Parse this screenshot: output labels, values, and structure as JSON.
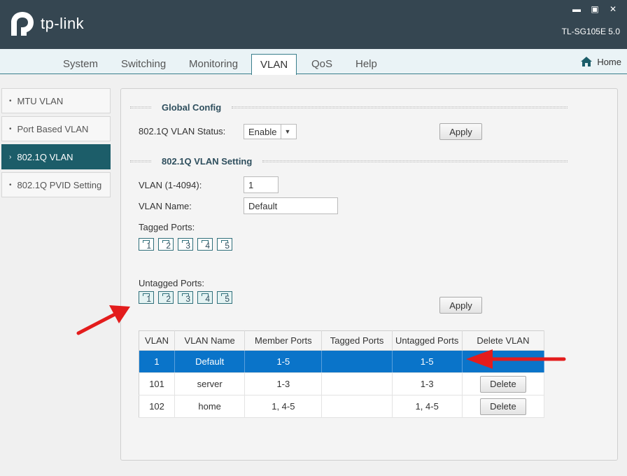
{
  "window": {
    "model": "TL-SG105E 5.0",
    "brand": "tp-link"
  },
  "tabs": [
    {
      "label": "System"
    },
    {
      "label": "Switching"
    },
    {
      "label": "Monitoring"
    },
    {
      "label": "VLAN"
    },
    {
      "label": "QoS"
    },
    {
      "label": "Help"
    }
  ],
  "home_label": "Home",
  "sidebar": [
    {
      "label": "MTU VLAN"
    },
    {
      "label": "Port Based VLAN"
    },
    {
      "label": "802.1Q VLAN"
    },
    {
      "label": "802.1Q PVID Setting"
    }
  ],
  "global": {
    "title": "Global Config",
    "status_label": "802.1Q VLAN Status:",
    "status_value": "Enable",
    "apply": "Apply"
  },
  "setting": {
    "title": "802.1Q VLAN Setting",
    "vlan_label": "VLAN (1-4094):",
    "vlan_value": "1",
    "name_label": "VLAN Name:",
    "name_value": "Default",
    "tagged_label": "Tagged Ports:",
    "untagged_label": "Untagged Ports:",
    "ports": [
      "1",
      "2",
      "3",
      "4",
      "5"
    ],
    "apply": "Apply"
  },
  "table": {
    "headers": [
      "VLAN",
      "VLAN Name",
      "Member Ports",
      "Tagged Ports",
      "Untagged Ports",
      "Delete VLAN"
    ],
    "rows": [
      {
        "vlan": "1",
        "name": "Default",
        "member": "1-5",
        "tagged": "",
        "untagged": "1-5",
        "delete": ""
      },
      {
        "vlan": "101",
        "name": "server",
        "member": "1-3",
        "tagged": "",
        "untagged": "1-3",
        "delete": "Delete"
      },
      {
        "vlan": "102",
        "name": "home",
        "member": "1, 4-5",
        "tagged": "",
        "untagged": "1, 4-5",
        "delete": "Delete"
      }
    ]
  },
  "colors": {
    "titlebar": "#354651",
    "accent": "#1c5d69",
    "selected_row": "#0a74c9",
    "annotation_arrow": "#e31c1c"
  }
}
